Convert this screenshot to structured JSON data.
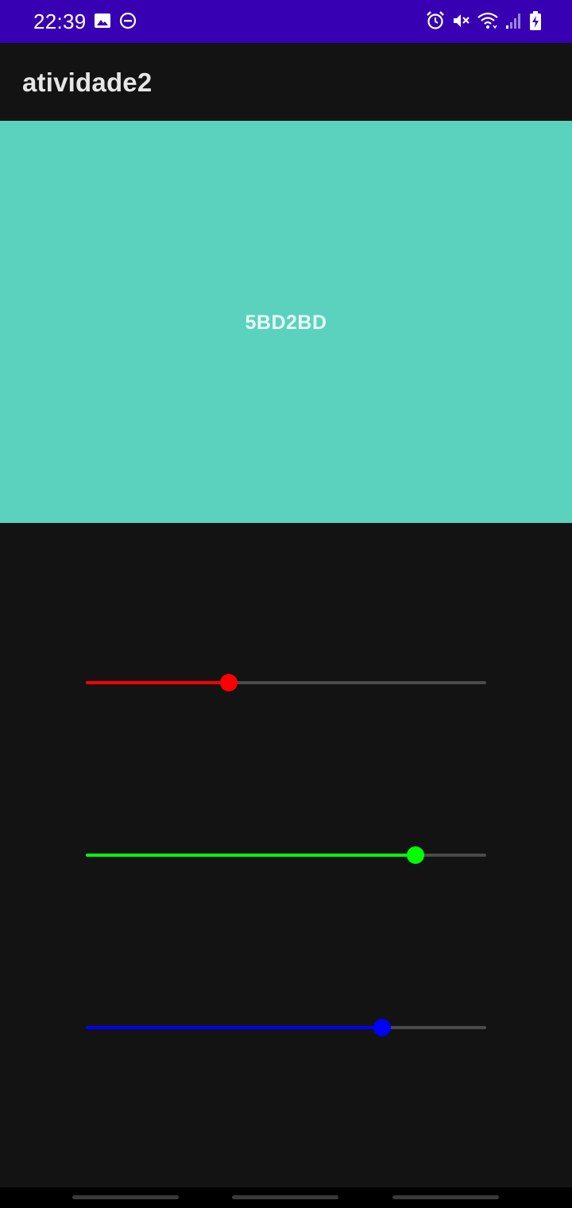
{
  "status_bar": {
    "time": "22:39",
    "left_icons": [
      "image-icon",
      "do-not-disturb-icon"
    ],
    "right_icons": [
      "alarm-icon",
      "mute-icon",
      "wifi-icon",
      "signal-icon",
      "battery-charging-icon"
    ]
  },
  "app_bar": {
    "title": "atividade2"
  },
  "color_preview": {
    "hex_label": "5BD2BD",
    "background": "#5BD2BD"
  },
  "sliders": [
    {
      "name": "red",
      "color": "#ff0000",
      "value": 0.357,
      "max_hint": 255
    },
    {
      "name": "green",
      "color": "#00ff00",
      "value": 0.823,
      "max_hint": 255
    },
    {
      "name": "blue",
      "color": "#0000ff",
      "value": 0.741,
      "max_hint": 255
    }
  ],
  "nav_bar": {
    "handles": 3
  }
}
